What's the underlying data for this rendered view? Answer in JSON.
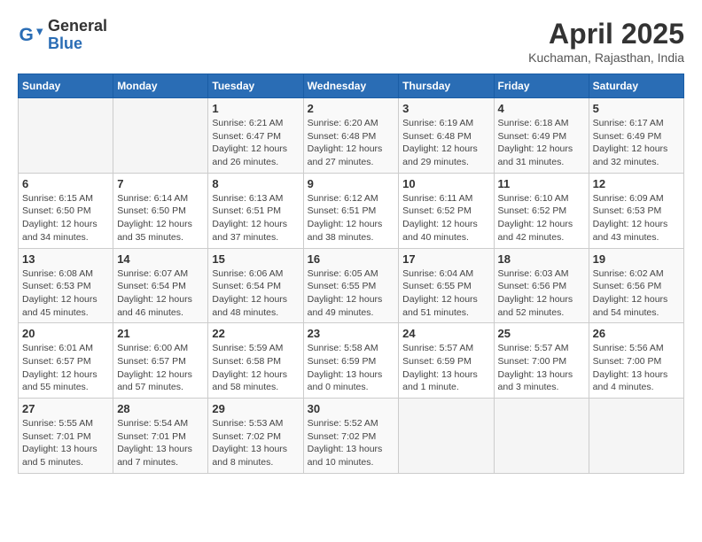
{
  "header": {
    "logo_general": "General",
    "logo_blue": "Blue",
    "month_year": "April 2025",
    "location": "Kuchaman, Rajasthan, India"
  },
  "weekdays": [
    "Sunday",
    "Monday",
    "Tuesday",
    "Wednesday",
    "Thursday",
    "Friday",
    "Saturday"
  ],
  "weeks": [
    [
      null,
      null,
      {
        "day": "1",
        "sunrise": "Sunrise: 6:21 AM",
        "sunset": "Sunset: 6:47 PM",
        "daylight": "Daylight: 12 hours and 26 minutes."
      },
      {
        "day": "2",
        "sunrise": "Sunrise: 6:20 AM",
        "sunset": "Sunset: 6:48 PM",
        "daylight": "Daylight: 12 hours and 27 minutes."
      },
      {
        "day": "3",
        "sunrise": "Sunrise: 6:19 AM",
        "sunset": "Sunset: 6:48 PM",
        "daylight": "Daylight: 12 hours and 29 minutes."
      },
      {
        "day": "4",
        "sunrise": "Sunrise: 6:18 AM",
        "sunset": "Sunset: 6:49 PM",
        "daylight": "Daylight: 12 hours and 31 minutes."
      },
      {
        "day": "5",
        "sunrise": "Sunrise: 6:17 AM",
        "sunset": "Sunset: 6:49 PM",
        "daylight": "Daylight: 12 hours and 32 minutes."
      }
    ],
    [
      {
        "day": "6",
        "sunrise": "Sunrise: 6:15 AM",
        "sunset": "Sunset: 6:50 PM",
        "daylight": "Daylight: 12 hours and 34 minutes."
      },
      {
        "day": "7",
        "sunrise": "Sunrise: 6:14 AM",
        "sunset": "Sunset: 6:50 PM",
        "daylight": "Daylight: 12 hours and 35 minutes."
      },
      {
        "day": "8",
        "sunrise": "Sunrise: 6:13 AM",
        "sunset": "Sunset: 6:51 PM",
        "daylight": "Daylight: 12 hours and 37 minutes."
      },
      {
        "day": "9",
        "sunrise": "Sunrise: 6:12 AM",
        "sunset": "Sunset: 6:51 PM",
        "daylight": "Daylight: 12 hours and 38 minutes."
      },
      {
        "day": "10",
        "sunrise": "Sunrise: 6:11 AM",
        "sunset": "Sunset: 6:52 PM",
        "daylight": "Daylight: 12 hours and 40 minutes."
      },
      {
        "day": "11",
        "sunrise": "Sunrise: 6:10 AM",
        "sunset": "Sunset: 6:52 PM",
        "daylight": "Daylight: 12 hours and 42 minutes."
      },
      {
        "day": "12",
        "sunrise": "Sunrise: 6:09 AM",
        "sunset": "Sunset: 6:53 PM",
        "daylight": "Daylight: 12 hours and 43 minutes."
      }
    ],
    [
      {
        "day": "13",
        "sunrise": "Sunrise: 6:08 AM",
        "sunset": "Sunset: 6:53 PM",
        "daylight": "Daylight: 12 hours and 45 minutes."
      },
      {
        "day": "14",
        "sunrise": "Sunrise: 6:07 AM",
        "sunset": "Sunset: 6:54 PM",
        "daylight": "Daylight: 12 hours and 46 minutes."
      },
      {
        "day": "15",
        "sunrise": "Sunrise: 6:06 AM",
        "sunset": "Sunset: 6:54 PM",
        "daylight": "Daylight: 12 hours and 48 minutes."
      },
      {
        "day": "16",
        "sunrise": "Sunrise: 6:05 AM",
        "sunset": "Sunset: 6:55 PM",
        "daylight": "Daylight: 12 hours and 49 minutes."
      },
      {
        "day": "17",
        "sunrise": "Sunrise: 6:04 AM",
        "sunset": "Sunset: 6:55 PM",
        "daylight": "Daylight: 12 hours and 51 minutes."
      },
      {
        "day": "18",
        "sunrise": "Sunrise: 6:03 AM",
        "sunset": "Sunset: 6:56 PM",
        "daylight": "Daylight: 12 hours and 52 minutes."
      },
      {
        "day": "19",
        "sunrise": "Sunrise: 6:02 AM",
        "sunset": "Sunset: 6:56 PM",
        "daylight": "Daylight: 12 hours and 54 minutes."
      }
    ],
    [
      {
        "day": "20",
        "sunrise": "Sunrise: 6:01 AM",
        "sunset": "Sunset: 6:57 PM",
        "daylight": "Daylight: 12 hours and 55 minutes."
      },
      {
        "day": "21",
        "sunrise": "Sunrise: 6:00 AM",
        "sunset": "Sunset: 6:57 PM",
        "daylight": "Daylight: 12 hours and 57 minutes."
      },
      {
        "day": "22",
        "sunrise": "Sunrise: 5:59 AM",
        "sunset": "Sunset: 6:58 PM",
        "daylight": "Daylight: 12 hours and 58 minutes."
      },
      {
        "day": "23",
        "sunrise": "Sunrise: 5:58 AM",
        "sunset": "Sunset: 6:59 PM",
        "daylight": "Daylight: 13 hours and 0 minutes."
      },
      {
        "day": "24",
        "sunrise": "Sunrise: 5:57 AM",
        "sunset": "Sunset: 6:59 PM",
        "daylight": "Daylight: 13 hours and 1 minute."
      },
      {
        "day": "25",
        "sunrise": "Sunrise: 5:57 AM",
        "sunset": "Sunset: 7:00 PM",
        "daylight": "Daylight: 13 hours and 3 minutes."
      },
      {
        "day": "26",
        "sunrise": "Sunrise: 5:56 AM",
        "sunset": "Sunset: 7:00 PM",
        "daylight": "Daylight: 13 hours and 4 minutes."
      }
    ],
    [
      {
        "day": "27",
        "sunrise": "Sunrise: 5:55 AM",
        "sunset": "Sunset: 7:01 PM",
        "daylight": "Daylight: 13 hours and 5 minutes."
      },
      {
        "day": "28",
        "sunrise": "Sunrise: 5:54 AM",
        "sunset": "Sunset: 7:01 PM",
        "daylight": "Daylight: 13 hours and 7 minutes."
      },
      {
        "day": "29",
        "sunrise": "Sunrise: 5:53 AM",
        "sunset": "Sunset: 7:02 PM",
        "daylight": "Daylight: 13 hours and 8 minutes."
      },
      {
        "day": "30",
        "sunrise": "Sunrise: 5:52 AM",
        "sunset": "Sunset: 7:02 PM",
        "daylight": "Daylight: 13 hours and 10 minutes."
      },
      null,
      null,
      null
    ]
  ]
}
